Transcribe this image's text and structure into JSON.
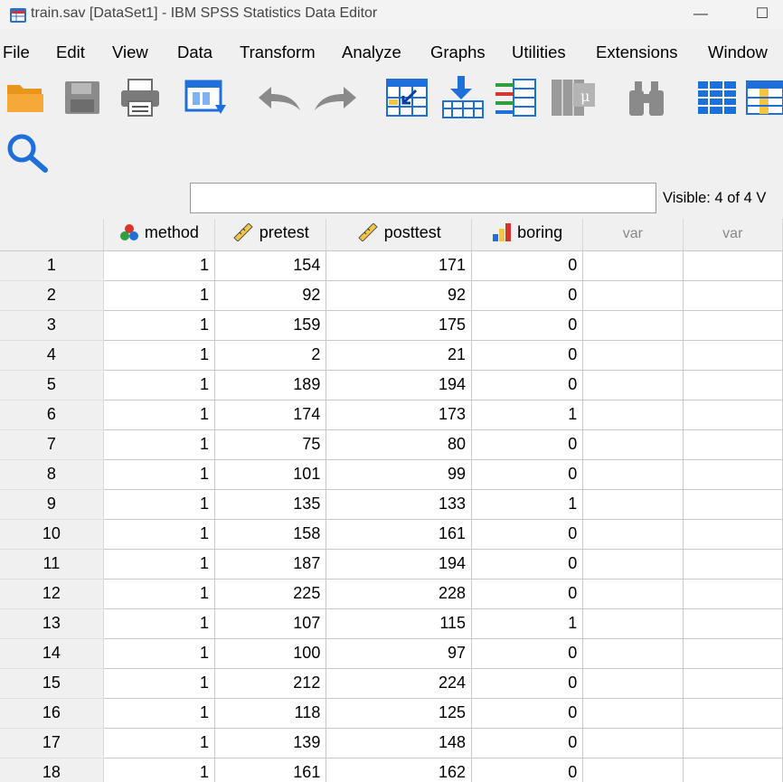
{
  "window": {
    "title": "train.sav [DataSet1] - IBM SPSS Statistics Data Editor",
    "minimize_glyph": "—",
    "maximize_glyph": "☐"
  },
  "menu": [
    {
      "label": "File"
    },
    {
      "label": "Edit"
    },
    {
      "label": "View"
    },
    {
      "label": "Data"
    },
    {
      "label": "Transform"
    },
    {
      "label": "Analyze"
    },
    {
      "label": "Graphs"
    },
    {
      "label": "Utilities"
    },
    {
      "label": "Extensions"
    },
    {
      "label": "Window"
    }
  ],
  "toolbar": {
    "icons": [
      "open-folder-icon",
      "save-icon",
      "print-icon",
      "recall-dialog-icon",
      "undo-icon",
      "redo-icon",
      "go-to-case-icon",
      "go-to-variable-icon",
      "variables-icon",
      "run-descriptives-icon",
      "find-icon",
      "insert-cases-icon",
      "insert-variable-icon",
      "search-icon"
    ]
  },
  "edit_bar": {
    "cell_value": "",
    "visible_label": "Visible: 4 of 4 V"
  },
  "grid": {
    "columns": [
      {
        "name": "method",
        "icon": "nominal-measure-icon"
      },
      {
        "name": "pretest",
        "icon": "scale-measure-icon"
      },
      {
        "name": "posttest",
        "icon": "scale-measure-icon"
      },
      {
        "name": "boring",
        "icon": "ordinal-measure-icon"
      },
      {
        "name": "var",
        "icon": ""
      },
      {
        "name": "var",
        "icon": ""
      }
    ],
    "rows": [
      {
        "n": "1",
        "method": "1",
        "pretest": "154",
        "posttest": "171",
        "boring": "0"
      },
      {
        "n": "2",
        "method": "1",
        "pretest": "92",
        "posttest": "92",
        "boring": "0"
      },
      {
        "n": "3",
        "method": "1",
        "pretest": "159",
        "posttest": "175",
        "boring": "0"
      },
      {
        "n": "4",
        "method": "1",
        "pretest": "2",
        "posttest": "21",
        "boring": "0"
      },
      {
        "n": "5",
        "method": "1",
        "pretest": "189",
        "posttest": "194",
        "boring": "0"
      },
      {
        "n": "6",
        "method": "1",
        "pretest": "174",
        "posttest": "173",
        "boring": "1"
      },
      {
        "n": "7",
        "method": "1",
        "pretest": "75",
        "posttest": "80",
        "boring": "0"
      },
      {
        "n": "8",
        "method": "1",
        "pretest": "101",
        "posttest": "99",
        "boring": "0"
      },
      {
        "n": "9",
        "method": "1",
        "pretest": "135",
        "posttest": "133",
        "boring": "1"
      },
      {
        "n": "10",
        "method": "1",
        "pretest": "158",
        "posttest": "161",
        "boring": "0"
      },
      {
        "n": "11",
        "method": "1",
        "pretest": "187",
        "posttest": "194",
        "boring": "0"
      },
      {
        "n": "12",
        "method": "1",
        "pretest": "225",
        "posttest": "228",
        "boring": "0"
      },
      {
        "n": "13",
        "method": "1",
        "pretest": "107",
        "posttest": "115",
        "boring": "1"
      },
      {
        "n": "14",
        "method": "1",
        "pretest": "100",
        "posttest": "97",
        "boring": "0"
      },
      {
        "n": "15",
        "method": "1",
        "pretest": "212",
        "posttest": "224",
        "boring": "0"
      },
      {
        "n": "16",
        "method": "1",
        "pretest": "118",
        "posttest": "125",
        "boring": "0"
      },
      {
        "n": "17",
        "method": "1",
        "pretest": "139",
        "posttest": "148",
        "boring": "0"
      },
      {
        "n": "18",
        "method": "1",
        "pretest": "161",
        "posttest": "162",
        "boring": "0"
      }
    ]
  },
  "colors": {
    "accent_blue": "#1e6fd9",
    "toolbar_gray": "#8a8a8a",
    "folder_orange": "#f0a030"
  }
}
